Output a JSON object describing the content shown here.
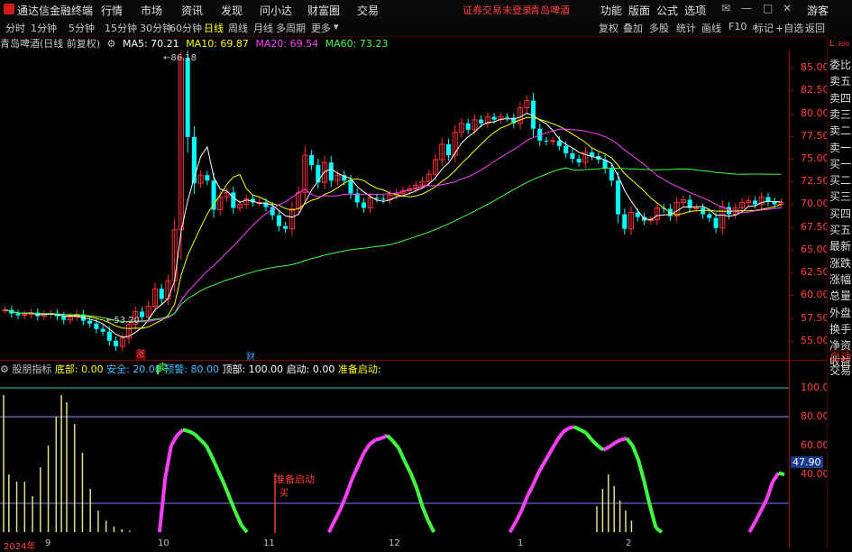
{
  "app": {
    "name": "通达信金融终端",
    "menu": [
      "行情",
      "市场",
      "资讯",
      "发现",
      "问小达",
      "财富圈",
      "交易"
    ],
    "login_warning": "证券交易未登录",
    "stock_title": "青岛啤酒",
    "right_menu": [
      "功能",
      "版面",
      "公式",
      "选项"
    ],
    "user": "游客"
  },
  "toolbar": {
    "timeframes": [
      "分时",
      "1分钟",
      "5分钟",
      "15分钟",
      "30分钟",
      "60分钟",
      "日线",
      "周线",
      "月线",
      "多周期",
      "更多"
    ],
    "active_timeframe": "日线",
    "buttons": [
      "复权",
      "叠加",
      "多股",
      "统计",
      "画线",
      "F10",
      "标记",
      "+自选",
      "返回"
    ]
  },
  "main_chart": {
    "stock_label": "青岛啤酒(日线 前复权)",
    "ma": [
      {
        "label": "MA5: 70.21",
        "color": "#ffffff"
      },
      {
        "label": "MA10: 69.87",
        "color": "#ffff00"
      },
      {
        "label": "MA20: 69.54",
        "color": "#ff40ff"
      },
      {
        "label": "MA60: 73.23",
        "color": "#40ff40"
      }
    ],
    "high_label": "86.18",
    "low_label": "53.20",
    "marker_zhang": "涨",
    "marker_cai": "财",
    "price_ticks": [
      "85.00",
      "82.50",
      "80.00",
      "77.50",
      "75.00",
      "72.50",
      "70.00",
      "67.50",
      "65.00",
      "62.50",
      "60.00",
      "57.50",
      "55.00"
    ]
  },
  "indicator": {
    "name": "股朋指标",
    "params": [
      {
        "label": "底部: 0.00",
        "color": "#ffff00"
      },
      {
        "label": "安全: 20.00",
        "color": "#40c0ff"
      },
      {
        "label": "预警: 80.00",
        "color": "#40c0ff"
      },
      {
        "label": "顶部: 100.00",
        "color": "#ffffff"
      },
      {
        "label": "启动: 0.00",
        "color": "#ffffff"
      },
      {
        "label": "准备启动:",
        "color": "#ffff00"
      }
    ],
    "ticks": [
      "100.0",
      "80.00",
      "60.00",
      "40.00"
    ],
    "current_value": "47.90",
    "sell_label": "卖",
    "prep_label": "准备启动",
    "prep_sub": "买"
  },
  "dates": [
    "2024年",
    "9",
    "10",
    "11",
    "12",
    "1",
    "2"
  ],
  "side_panel": {
    "badge_l": "L",
    "badge_num": "300",
    "items": [
      "委比",
      "卖五",
      "卖四",
      "卖三",
      "卖二",
      "卖一",
      "买一",
      "买二",
      "买三",
      "买四",
      "买五",
      "最新",
      "涨跌",
      "涨幅",
      "总量",
      "外盘",
      "换手",
      "净资",
      "收益"
    ],
    "bottom_items": [
      "自动",
      "交易"
    ]
  },
  "chart_data": {
    "type": "candlestick",
    "title": "青岛啤酒(日线 前复权)",
    "ylim": [
      53.2,
      86.5
    ],
    "closes": [
      58.4,
      58.0,
      57.8,
      57.9,
      58.1,
      57.7,
      57.9,
      58.0,
      57.7,
      57.3,
      57.6,
      57.9,
      57.2,
      56.9,
      56.3,
      56.0,
      55.0,
      54.4,
      55.3,
      56.8,
      58.2,
      57.6,
      58.8,
      60.7,
      59.6,
      61.6,
      67.2,
      86.1,
      77.4,
      72.3,
      73.2,
      72.6,
      69.4,
      70.8,
      71.3,
      69.6,
      70.0,
      70.6,
      70.2,
      70.2,
      69.7,
      68.8,
      67.6,
      67.3,
      69.5,
      71.3,
      75.4,
      74.3,
      72.4,
      74.6,
      72.6,
      73.2,
      72.6,
      71.2,
      70.2,
      69.6,
      70.7,
      70.6,
      70.5,
      71.0,
      71.2,
      71.5,
      71.7,
      72.1,
      72.5,
      73.3,
      74.9,
      76.6,
      75.4,
      77.9,
      78.9,
      78.2,
      79.3,
      78.9,
      79.6,
      79.3,
      79.6,
      79.5,
      78.9,
      80.6,
      81.4,
      78.3,
      77.0,
      76.9,
      77.0,
      76.4,
      75.6,
      75.0,
      74.6,
      75.7,
      75.3,
      74.9,
      73.9,
      72.6,
      68.9,
      67.3,
      69.1,
      68.6,
      68.2,
      68.3,
      69.6,
      69.5,
      68.7,
      70.2,
      70.5,
      69.6,
      69.6,
      68.9,
      68.5,
      67.4,
      69.7,
      68.9,
      69.6,
      70.2,
      70.4,
      70.0,
      70.8,
      70.3,
      70.0,
      70.2
    ],
    "series": [
      {
        "name": "MA5",
        "color": "#ffffff"
      },
      {
        "name": "MA10",
        "color": "#ffff00"
      },
      {
        "name": "MA20",
        "color": "#ff40ff"
      },
      {
        "name": "MA60",
        "color": "#40ff40"
      }
    ],
    "indicator": {
      "name": "股朋指标",
      "ylim": [
        0,
        100
      ],
      "lines": [
        100,
        80,
        20
      ],
      "oscillator": [
        0,
        0,
        0,
        0,
        0,
        0,
        0,
        0,
        0,
        0,
        0,
        0,
        0,
        0,
        0,
        0,
        0,
        0,
        0,
        0,
        0,
        0,
        0,
        0,
        0,
        0,
        0,
        38,
        60,
        67,
        71,
        70,
        68,
        64,
        60,
        52,
        43,
        34,
        24,
        14,
        5,
        0,
        0,
        0,
        0,
        0,
        0,
        0,
        0,
        0,
        0,
        0,
        0,
        0,
        0,
        0,
        8,
        16,
        26,
        37,
        46,
        55,
        61,
        64,
        65,
        67,
        63,
        58,
        49,
        41,
        31,
        18,
        8,
        0,
        0,
        0,
        0,
        0,
        0,
        0,
        0,
        0,
        0,
        0,
        0,
        0,
        0,
        7,
        15,
        25,
        33,
        42,
        49,
        56,
        63,
        69,
        72,
        73,
        71,
        69,
        64,
        60,
        57,
        59,
        62,
        64,
        65,
        60,
        50,
        35,
        18,
        3,
        0,
        0,
        0,
        0,
        0,
        0,
        0,
        0,
        0,
        0,
        0,
        0,
        0,
        0,
        0,
        0,
        7,
        15,
        23,
        35,
        41,
        40
      ],
      "current": 47.9
    }
  }
}
